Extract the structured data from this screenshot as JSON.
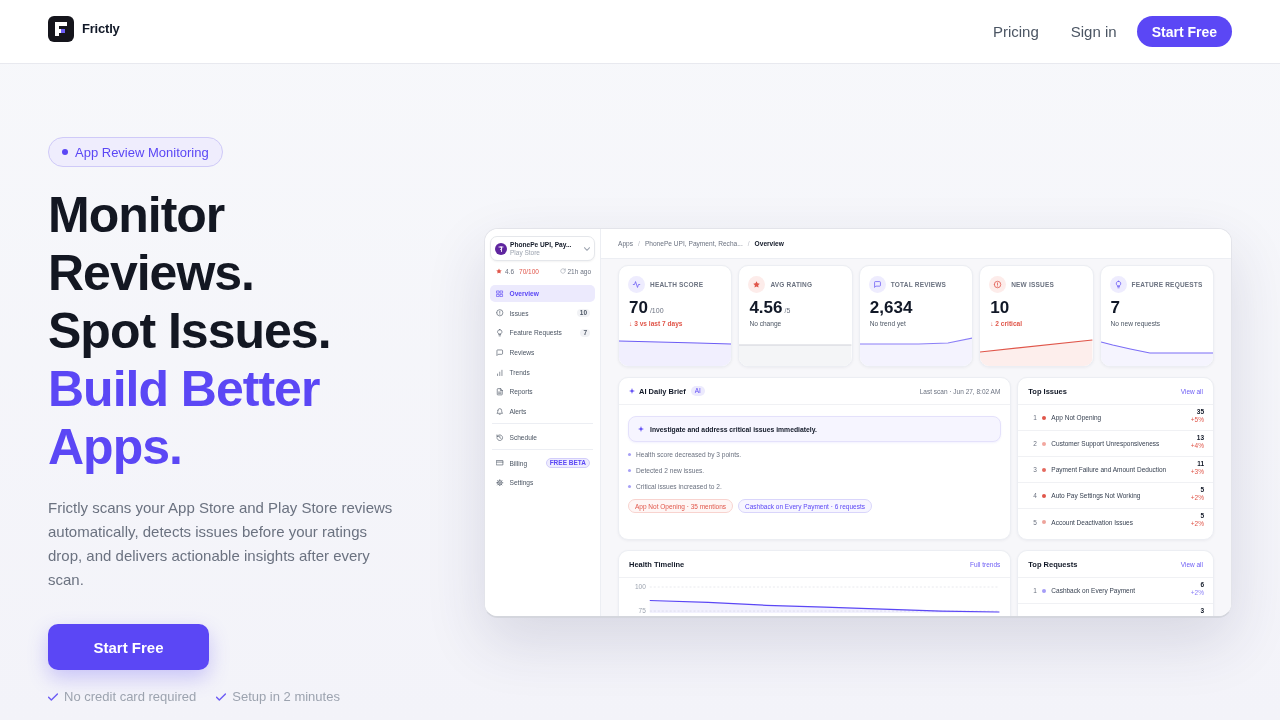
{
  "header": {
    "logo_text": "Frictly",
    "nav": [
      "Pricing",
      "Sign in"
    ],
    "cta": "Start Free"
  },
  "hero": {
    "badge": "App Review Monitoring",
    "heading": [
      {
        "text": "Monitor Reviews.",
        "accent": false
      },
      {
        "text": "Spot Issues.",
        "accent": false
      },
      {
        "text": "Build Better Apps.",
        "accent": true
      }
    ],
    "description": "Frictly scans your App Store and Play Store reviews automatically, detects issues before your ratings drop, and delivers actionable insights after every scan.",
    "cta": "Start Free",
    "perks": [
      "No credit card required",
      "Setup in 2 minutes"
    ]
  },
  "dashboard": {
    "sidebar": {
      "app_name": "PhonePe UPI, Pay...",
      "app_store": "Play Store",
      "rating": "4.6",
      "score": "70/100",
      "synced": "21h ago",
      "nav_groups": [
        [
          {
            "label": "Overview",
            "selected": true
          },
          {
            "label": "Issues",
            "count": "10",
            "selected": false
          },
          {
            "label": "Feature Requests",
            "count": "7",
            "selected": false
          },
          {
            "label": "Reviews",
            "selected": false
          },
          {
            "label": "Trends",
            "selected": false
          },
          {
            "label": "Reports",
            "selected": false
          },
          {
            "label": "Alerts",
            "selected": false
          }
        ],
        [
          {
            "label": "Schedule",
            "selected": false
          }
        ],
        [
          {
            "label": "Billing",
            "tag": "FREE BETA",
            "selected": false
          },
          {
            "label": "Settings",
            "selected": false
          }
        ]
      ]
    },
    "breadcrumb": {
      "items": [
        {
          "label": "Apps",
          "current": false
        },
        {
          "label": "PhonePe UPI, Payment, Recha...",
          "current": false
        },
        {
          "label": "Overview",
          "current": true
        }
      ],
      "separators": [
        "/",
        "/"
      ]
    },
    "stats": [
      {
        "label": "HEALTH SCORE",
        "value": "70",
        "unit": "/100",
        "note": "↓ 3 vs last 7 days",
        "negative": true
      },
      {
        "label": "AVG RATING",
        "value": "4.56",
        "unit": "/5",
        "note": "No change",
        "negative": false
      },
      {
        "label": "TOTAL REVIEWS",
        "value": "2,634",
        "note": "No trend yet",
        "negative": false
      },
      {
        "label": "NEW ISSUES",
        "value": "10",
        "note": "↓ 2 critical",
        "negative": true
      },
      {
        "label": "FEATURE REQUESTS",
        "value": "7",
        "note": "No new requests",
        "negative": false
      }
    ],
    "brief": {
      "title": "AI Daily Brief",
      "badge": "AI",
      "last_scan": "Last scan · Jun 27, 8:02 AM",
      "headline": "Investigate and address critical issues immediately.",
      "points": [
        "Health score decreased by 3 points.",
        "Detected 2 new issues.",
        "Critical issues increased to 2."
      ],
      "tags": [
        {
          "label": "App Not Opening · 35 mentions",
          "kind": "issue"
        },
        {
          "label": "Cashback on Every Payment · 6 requests",
          "kind": "request"
        }
      ]
    },
    "top_issues": {
      "title": "Top Issues",
      "link": "View all",
      "rows": [
        {
          "rank": "1",
          "name": "App Not Opening",
          "count": "35",
          "change": "+5%",
          "color": "#e0564a"
        },
        {
          "rank": "2",
          "name": "Customer Support Unresponsiveness",
          "count": "13",
          "change": "+4%",
          "color": "#f2a79f"
        },
        {
          "rank": "3",
          "name": "Payment Failure and Amount Deduction",
          "count": "11",
          "change": "+3%",
          "color": "#e46a5f"
        },
        {
          "rank": "4",
          "name": "Auto Pay Settings Not Working",
          "count": "5",
          "change": "+2%",
          "color": "#e0564a"
        },
        {
          "rank": "5",
          "name": "Account Deactivation Issues",
          "count": "5",
          "change": "+2%",
          "color": "#eea39b"
        }
      ]
    },
    "health_timeline": {
      "title": "Health Timeline",
      "link": "Full trends",
      "chart_data": {
        "type": "area",
        "ylim": [
          73,
          100
        ],
        "yticks": [
          75,
          100
        ],
        "series": [
          {
            "color": "#5b47f5",
            "values": [
              86,
              84,
              81,
              79,
              77,
              75,
              74
            ]
          }
        ]
      }
    },
    "top_requests": {
      "title": "Top Requests",
      "link": "View all",
      "rows": [
        {
          "rank": "1",
          "name": "Cashback on Every Payment",
          "count": "6",
          "change": "+2%",
          "color": "#a59cf7"
        },
        {
          "count": "3"
        }
      ]
    }
  }
}
